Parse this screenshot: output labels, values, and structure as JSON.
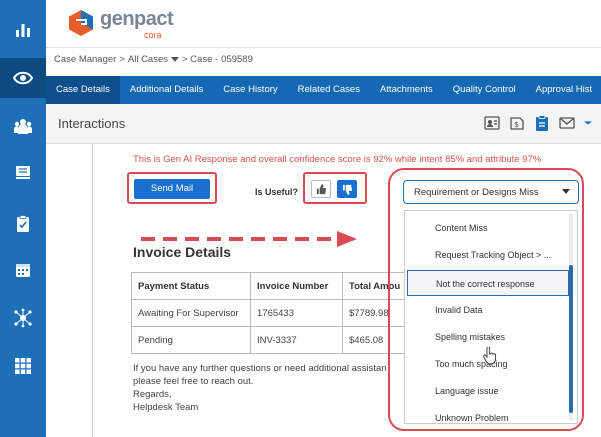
{
  "app": {
    "logo": {
      "name": "genpact",
      "sub": "cora"
    }
  },
  "sidebar": {
    "items": [
      {
        "icon": "bar-chart-icon",
        "active": false
      },
      {
        "icon": "eye-icon",
        "active": true
      },
      {
        "icon": "users-icon",
        "active": false
      },
      {
        "icon": "book-icon",
        "active": false
      },
      {
        "icon": "clipboard-icon",
        "active": false
      },
      {
        "icon": "calendar-icon",
        "active": false
      },
      {
        "icon": "network-icon",
        "active": false
      },
      {
        "icon": "grid-icon",
        "active": false
      }
    ]
  },
  "breadcrumb": {
    "case_manager": "Case Manager",
    "sep1": ">",
    "all_cases": "All Cases",
    "sep2": "> Case -",
    "case_id": "059589"
  },
  "tabs": [
    {
      "label": "Case Details",
      "active": true
    },
    {
      "label": "Additional Details",
      "active": false
    },
    {
      "label": "Case History",
      "active": false
    },
    {
      "label": "Related Cases",
      "active": false
    },
    {
      "label": "Attachments",
      "active": false
    },
    {
      "label": "Quality Control",
      "active": false
    },
    {
      "label": "Approval Hist",
      "active": false
    }
  ],
  "interactions": {
    "title": "Interactions",
    "icons": [
      "contact-card-icon",
      "dollar-note-icon",
      "clipboard-icon",
      "mail-icon",
      "chevron-down-icon"
    ]
  },
  "genai": {
    "message": "This is Gen AI Response and overall confidence score is 92% while intent 85% and attribute 97%"
  },
  "actions": {
    "send_mail": "Send Mail",
    "is_useful": "Is Useful?",
    "thumbs_up_icon": "thumbs-up-icon",
    "thumbs_down_icon": "thumbs-down-icon"
  },
  "invoice": {
    "title": "Invoice Details",
    "columns": [
      "Payment Status",
      "Invoice Number",
      "Total Amou"
    ],
    "rows": [
      [
        "Awaiting For Supervisor",
        "1765433",
        "$7789.98"
      ],
      [
        "Pending",
        "INV-3337",
        "$465.08"
      ]
    ],
    "closing": [
      "If you have any further questions or need additional assistan",
      "please feel free to reach out.",
      "Regards,",
      "Helpdesk Team"
    ]
  },
  "feedback_dropdown": {
    "selected": "Requirement or Designs Miss",
    "options": [
      {
        "label": "Content Miss",
        "highlighted": false
      },
      {
        "label": "Request Tracking Object > ...",
        "highlighted": false
      },
      {
        "label": "Not the correct response",
        "highlighted": true
      },
      {
        "label": "Invalid Data",
        "highlighted": false
      },
      {
        "label": "Spelling mistakes",
        "highlighted": false
      },
      {
        "label": "Too much spacing",
        "highlighted": false
      },
      {
        "label": "Language issue",
        "highlighted": false
      },
      {
        "label": "Unknown Problem",
        "highlighted": false
      }
    ]
  },
  "colors": {
    "sidebar": "#1d6fb8",
    "tab_bar": "#1568b3",
    "primary_button": "#1a6fd0",
    "highlight_box": "#d94b55",
    "genai_text": "#d9534f"
  }
}
